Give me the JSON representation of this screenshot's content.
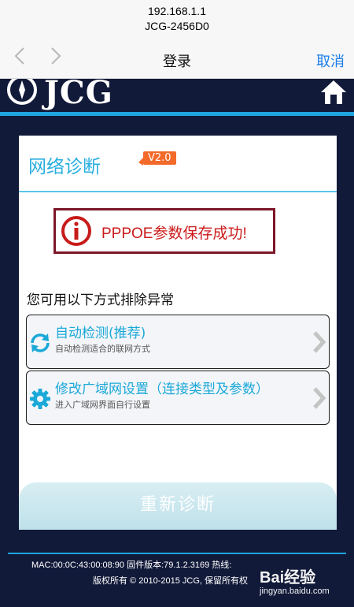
{
  "browser": {
    "host": "192.168.1.1",
    "page_title": "JCG-2456D0",
    "nav_title": "登录",
    "cancel_label": "取消"
  },
  "header": {
    "brand": "JCG",
    "accent_color": "#1ea5e0"
  },
  "card": {
    "title": "网络诊断",
    "version": "V2.0",
    "success_message": "PPPOE参数保存成功!",
    "hint": "您可用以下方式排除异常",
    "options": [
      {
        "title": "自动检测(推荐)",
        "subtitle": "自动检测适合的联网方式",
        "icon": "refresh-icon"
      },
      {
        "title": "修改广域网设置（连接类型及参数）",
        "subtitle": "进入广域网界面自行设置",
        "icon": "gear-icon"
      }
    ],
    "rediagnose_label": "重新诊断"
  },
  "footer": {
    "info": "MAC:00:0C:43:00:08:90  固件版本:79.1.2.3169  热线:",
    "copyright": "版权所有 © 2010-2015 JCG, 保留所有权"
  },
  "watermark": {
    "logo": "Bai经验",
    "url": "jingyan.baidu.com"
  }
}
